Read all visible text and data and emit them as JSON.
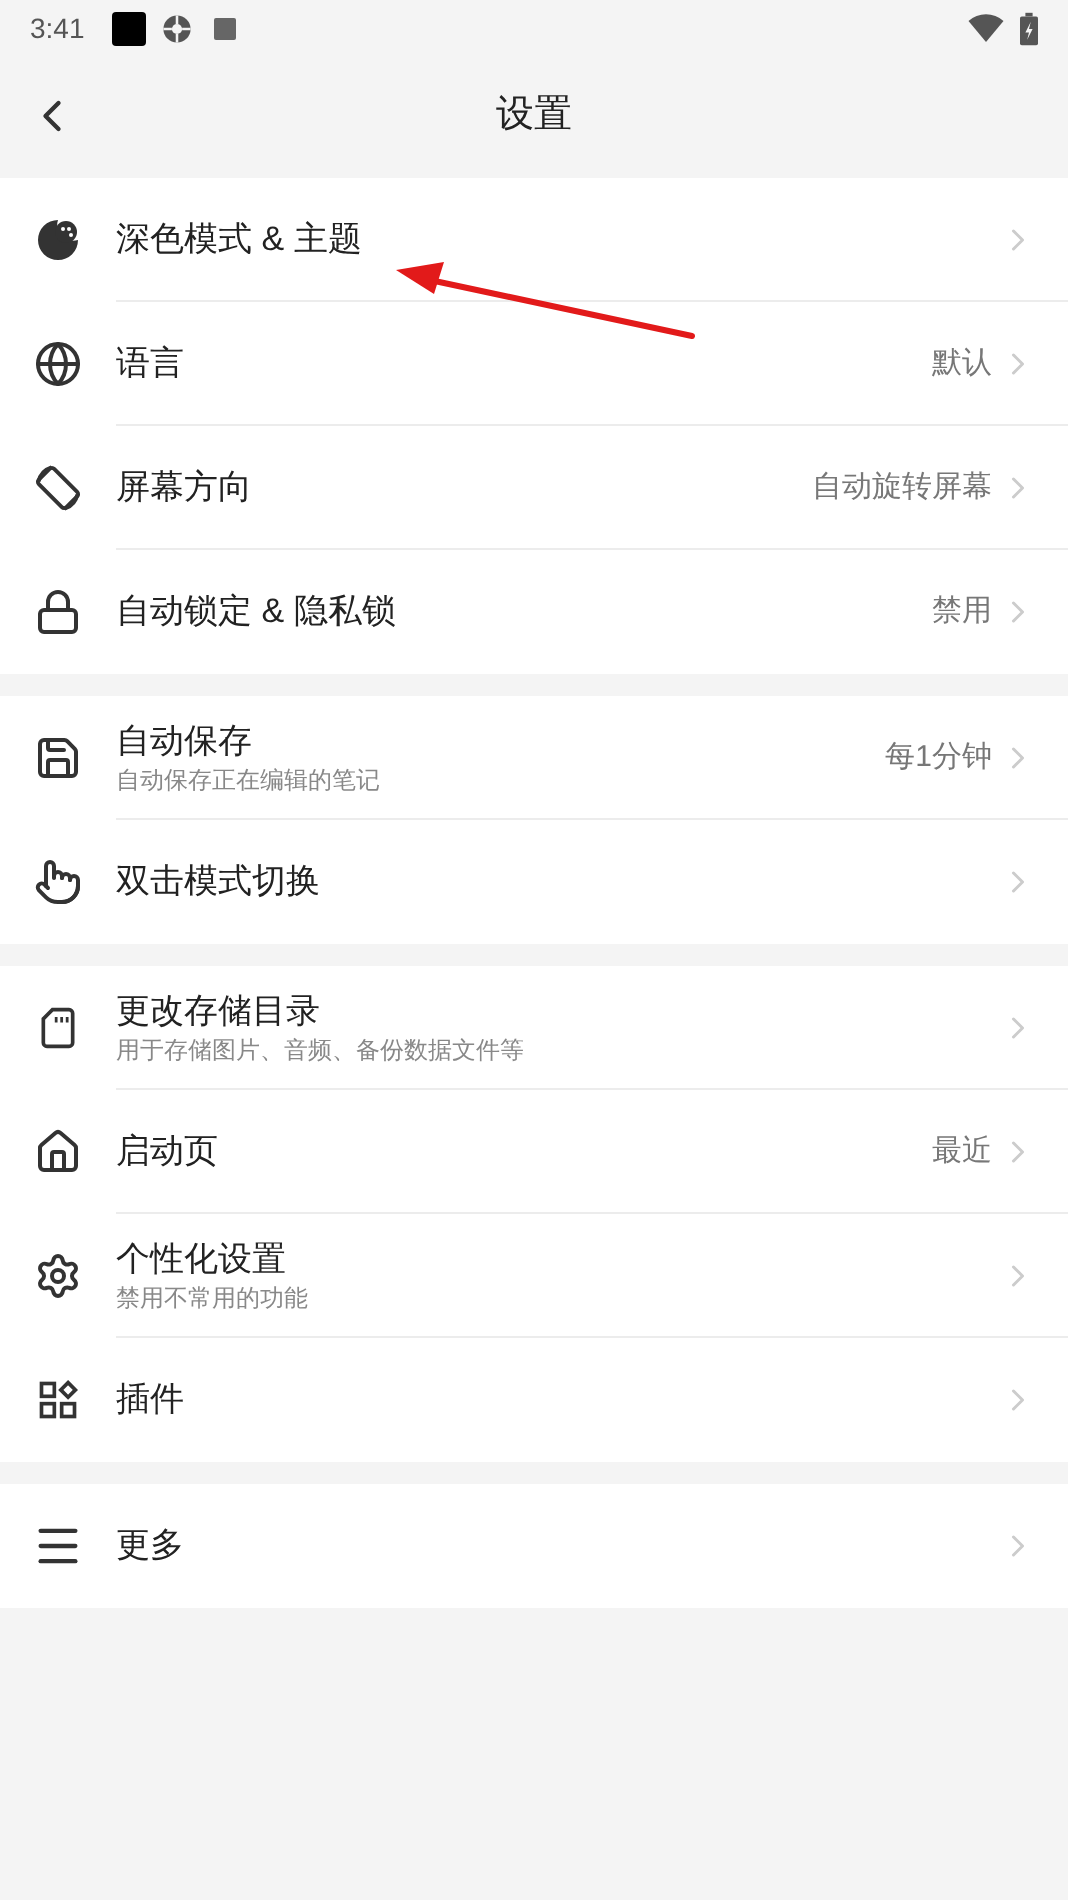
{
  "status_bar": {
    "time": "3:41"
  },
  "header": {
    "title": "设置"
  },
  "groups": [
    {
      "items": [
        {
          "title": "深色模式 & 主题"
        },
        {
          "title": "语言",
          "value": "默认"
        },
        {
          "title": "屏幕方向",
          "value": "自动旋转屏幕"
        },
        {
          "title": "自动锁定 & 隐私锁",
          "value": "禁用"
        }
      ]
    },
    {
      "items": [
        {
          "title": "自动保存",
          "subtitle": "自动保存正在编辑的笔记",
          "value": "每1分钟"
        },
        {
          "title": "双击模式切换"
        }
      ]
    },
    {
      "items": [
        {
          "title": "更改存储目录",
          "subtitle": "用于存储图片、音频、备份数据文件等"
        },
        {
          "title": "启动页",
          "value": "最近"
        },
        {
          "title": "个性化设置",
          "subtitle": "禁用不常用的功能"
        },
        {
          "title": "插件"
        }
      ]
    },
    {
      "items": [
        {
          "title": "更多"
        }
      ]
    }
  ]
}
